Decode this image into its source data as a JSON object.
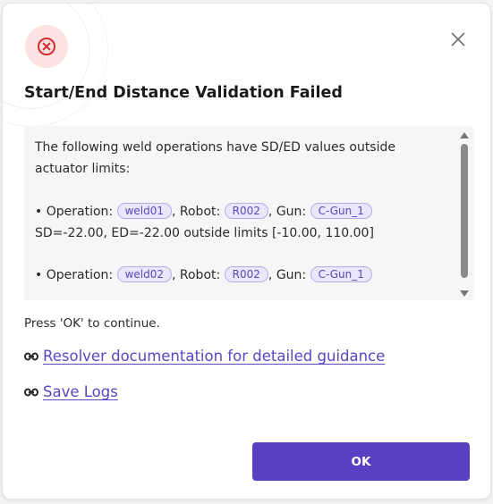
{
  "dialog": {
    "title": "Start/End Distance Validation Failed",
    "status_icon": "error-circle-x-icon",
    "close_icon": "close-icon",
    "colors": {
      "error_icon": "#d82b2b",
      "error_icon_bg": "#fde3e3",
      "accent": "#5a3fc2",
      "link": "#5b45c4",
      "chip_bg": "#ebe6fb",
      "chip_border": "#b9addf"
    }
  },
  "message": {
    "intro_line1": "The following weld operations have SD/ED values outside",
    "intro_line2": "actuator limits:",
    "entries": [
      {
        "bullet": "•",
        "operation_label": "Operation:",
        "operation": "weld01",
        "robot_label": "Robot:",
        "robot": "R002",
        "gun_label": "Gun:",
        "gun": "C-Gun_1",
        "detail": "SD=-22.00, ED=-22.00 outside limits [-10.00, 110.00]"
      },
      {
        "bullet": "•",
        "operation_label": "Operation:",
        "operation": "weld02",
        "robot_label": "Robot:",
        "robot": "R002",
        "gun_label": "Gun:",
        "gun": "C-Gun_1"
      }
    ]
  },
  "footer": {
    "continue_text": "Press 'OK' to continue.",
    "docs_link": "Resolver documentation for detailed guidance",
    "docs_icon": "link-icon",
    "logs_link": "Save Logs",
    "logs_icon": "link-icon",
    "ok_label": "OK"
  }
}
